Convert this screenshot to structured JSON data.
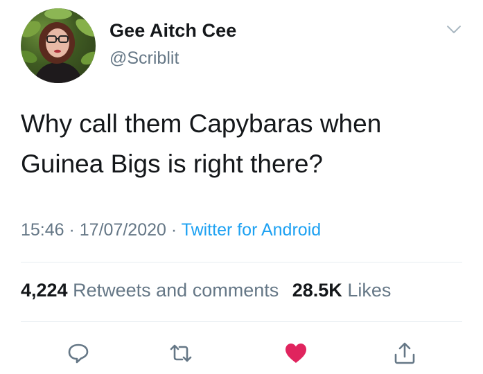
{
  "user": {
    "display_name": "Gee Aitch Cee",
    "handle": "@Scriblit"
  },
  "tweet": {
    "text_line1": "Why call them Capybaras when",
    "text_line2": "Guinea Bigs is right there?"
  },
  "meta": {
    "time": "15:46",
    "separator1": " · ",
    "date": "17/07/2020",
    "separator2": " · ",
    "source": "Twitter for Android"
  },
  "stats": {
    "retweets_count": "4,224",
    "retweets_label": "Retweets and comments",
    "likes_count": "28.5K",
    "likes_label": "Likes"
  },
  "actions": {
    "reply_icon": "reply-icon",
    "retweet_icon": "retweet-icon",
    "like_icon": "heart-icon",
    "share_icon": "share-icon"
  },
  "colors": {
    "text": "#14171a",
    "secondary": "#657786",
    "link": "#1da1f2",
    "like": "#e0245e",
    "divider": "#e6ecf0"
  }
}
